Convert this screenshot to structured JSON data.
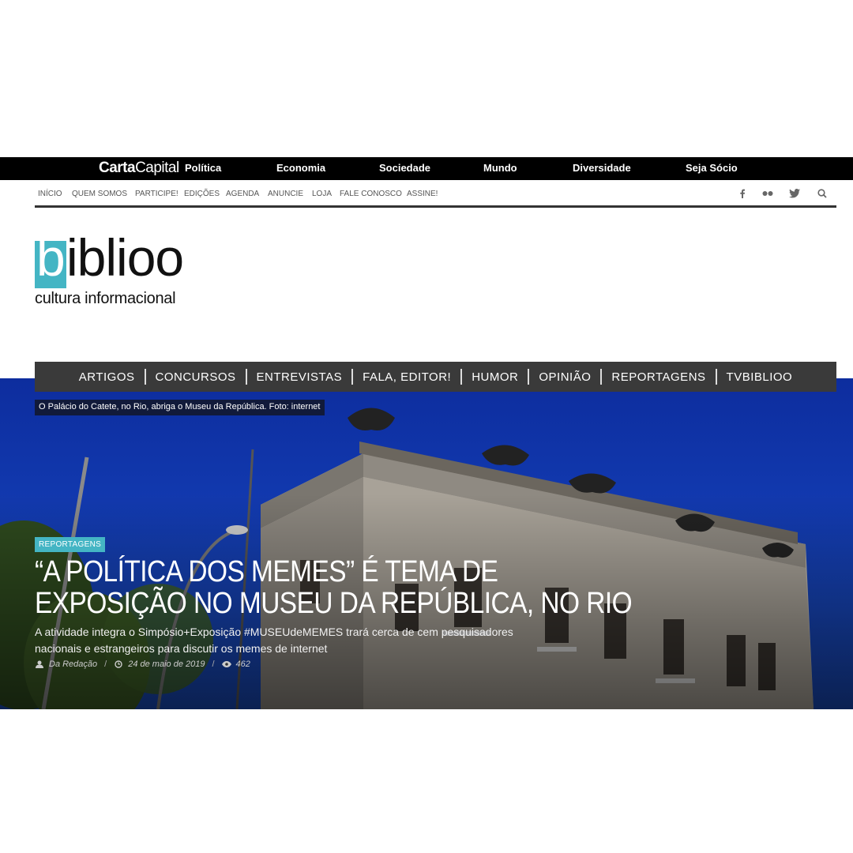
{
  "topbar": {
    "logo_bold": "Carta",
    "logo_regular": "Capital",
    "links": [
      "Política",
      "Economia",
      "Sociedade",
      "Mundo",
      "Diversidade",
      "Seja Sócio"
    ]
  },
  "secondary_nav": {
    "links": [
      "INÍCIO",
      "QUEM SOMOS",
      "PARTICIPE!",
      "EDIÇÕES",
      "AGENDA",
      "ANUNCIE",
      "LOJA",
      "FALE CONOSCO",
      "ASSINE!"
    ],
    "social_icons": [
      "facebook-icon",
      "flickr-icon",
      "twitter-icon",
      "search-icon"
    ]
  },
  "brand": {
    "logo_letter": "b",
    "logo_rest": "iblioo",
    "tagline": "cultura informacional",
    "accent_color": "#44b5c4"
  },
  "categories": [
    "ARTIGOS",
    "CONCURSOS",
    "ENTREVISTAS",
    "FALA, EDITOR!",
    "HUMOR",
    "OPINIÃO",
    "REPORTAGENS",
    "TVBIBLIOO"
  ],
  "hero": {
    "caption": "O Palácio do Catete, no Rio, abriga o Museu da República. Foto: internet",
    "tag": "REPORTAGENS",
    "headline_line1": "“A POLÍTICA DOS MEMES” É TEMA DE",
    "headline_line2": "EXPOSIÇÃO NO MUSEU DA REPÚBLICA, NO RIO",
    "summary_line1": "A atividade integra o Simpósio+Exposição #MUSEUdeMEMES trará cerca de cem pesquisadores",
    "summary_line2": "nacionais e estrangeiros para discutir os memes de internet",
    "author": "Da Redação",
    "date": "24 de maio de 2019",
    "views": "462"
  }
}
